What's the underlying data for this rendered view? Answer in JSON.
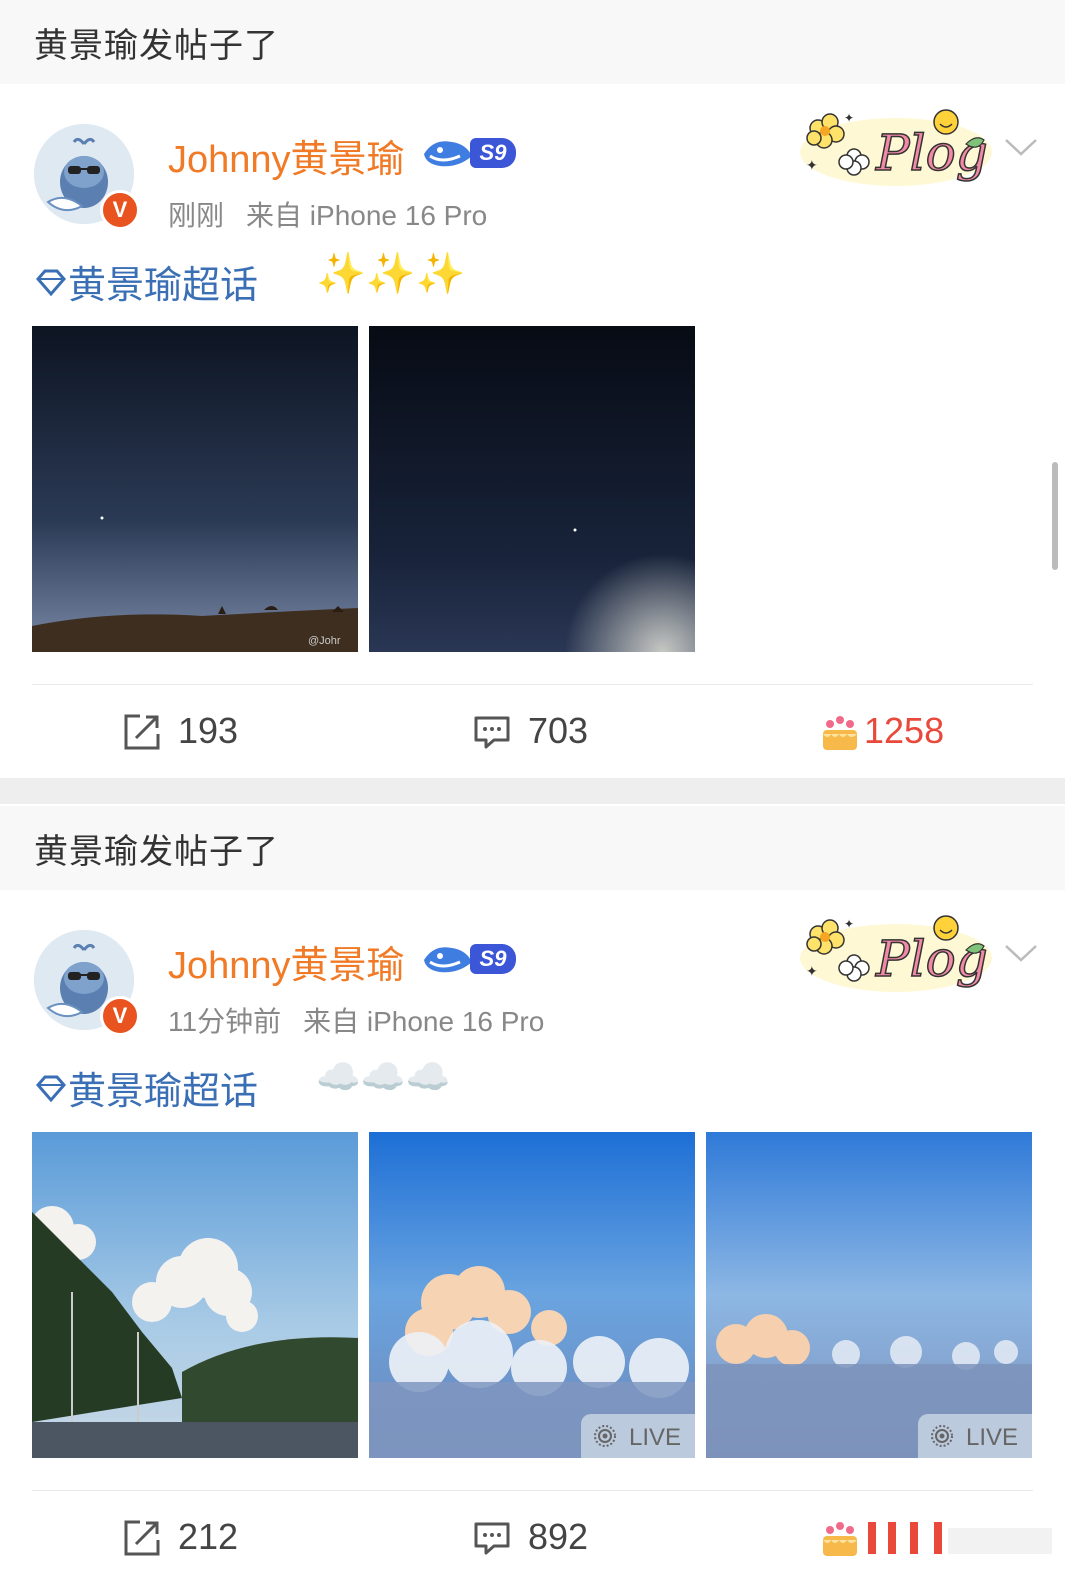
{
  "posts": [
    {
      "section_header": "黄景瑜发帖子了",
      "username": "Johnny黄景瑜",
      "level_badge": "S9",
      "avatar_badge": "V",
      "time": "刚刚",
      "source": "来自 iPhone 16 Pro",
      "topic": "黄景瑜超话",
      "emoji": "✨✨✨",
      "photos": [
        {
          "kind": "night-desert",
          "watermark": "@Johr"
        },
        {
          "kind": "night-sky"
        }
      ],
      "actions": {
        "repost": "193",
        "comment": "703",
        "like": "1258"
      }
    },
    {
      "section_header": "黄景瑜发帖子了",
      "username": "Johnny黄景瑜",
      "level_badge": "S9",
      "avatar_badge": "V",
      "time": "11分钟前",
      "source": "来自 iPhone 16 Pro",
      "topic": "黄景瑜超话",
      "emoji": "☁️☁️☁️",
      "photos": [
        {
          "kind": "road-clouds"
        },
        {
          "kind": "clouds-sunset",
          "badge": "LIVE"
        },
        {
          "kind": "clouds-horizon",
          "badge": "LIVE"
        }
      ],
      "actions": {
        "repost": "212",
        "comment": "892",
        "like": ""
      }
    }
  ],
  "colors": {
    "username": "#f07a26",
    "topic": "#3a6fb5",
    "like": "#e8493a",
    "meta": "#888888"
  },
  "icons": [
    "repost-icon",
    "comment-icon",
    "like-cake-icon",
    "chevron-down-icon",
    "diamond-icon",
    "verified-v-icon",
    "whale-level-icon",
    "plog-sticker"
  ]
}
